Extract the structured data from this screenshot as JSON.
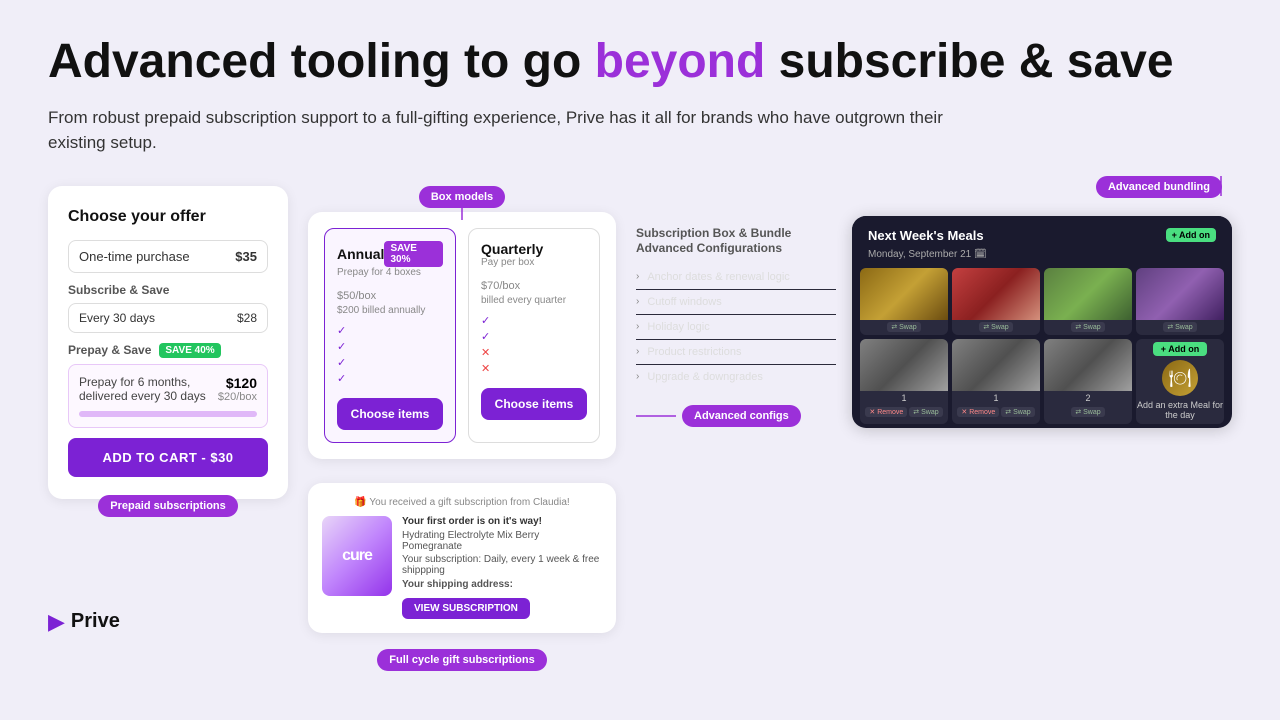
{
  "page": {
    "background": "#f0eef8"
  },
  "header": {
    "title_part1": "Advanced tooling to go ",
    "title_highlight": "beyond",
    "title_part2": " subscribe & save",
    "subtitle": "From robust prepaid subscription support to a full-gifting experience, Prive has it all for brands who have outgrown their existing setup."
  },
  "offer_card": {
    "title": "Choose your offer",
    "one_time": {
      "label": "One-time purchase",
      "price": "$35"
    },
    "subscribe_save": {
      "label": "Subscribe & Save",
      "frequency": "Every 30 days",
      "price": "$28"
    },
    "prepay_save": {
      "label": "Prepay & Save",
      "badge": "SAVE 40%",
      "description": "Prepay for 6 months, delivered every 30 days",
      "price": "$120",
      "per_box": "$20/box"
    },
    "add_to_cart": "ADD TO CART - $30",
    "tooltip": "Prepaid subscriptions"
  },
  "box_models": {
    "tooltip": "Box models",
    "annual": {
      "name": "Annual",
      "badge": "SAVE 30%",
      "sub": "Prepay for 4 boxes",
      "price": "$50",
      "per": "/box",
      "billed": "$200 billed annually",
      "features": [
        "check",
        "check",
        "check",
        "check"
      ],
      "btn": "Choose items"
    },
    "quarterly": {
      "name": "Quarterly",
      "sub": "Pay per box",
      "price": "$70",
      "per": "/box",
      "billed": "billed every quarter",
      "features": [
        "check",
        "check",
        "cross",
        "cross"
      ],
      "btn": "Choose items"
    }
  },
  "gift_card": {
    "header": "🎁 You received a gift subscription from Claudia!",
    "order_label": "Your first order is on it's way!",
    "product": "Hydrating Electrolyte Mix Berry Pomegranate",
    "details": "Your subscription: Daily, every 1 week & free shippping",
    "address_label": "Your shipping address:",
    "product_name": "cure",
    "subscribe_btn": "VIEW SUBSCRIPTION",
    "tooltip": "Full cycle gift subscriptions"
  },
  "dark_panel": {
    "title": "Next Week's Meals",
    "date": "Monday, September 21 🗓",
    "add_btn": "+ Add on",
    "meals": [
      {
        "img_class": "meal-img-1",
        "num": ""
      },
      {
        "img_class": "meal-img-2",
        "num": ""
      },
      {
        "img_class": "meal-img-3",
        "num": ""
      },
      {
        "img_class": "meal-img-4",
        "num": ""
      }
    ],
    "meals_row2": [
      {
        "img_class": "meal-img-5",
        "num": "1"
      },
      {
        "img_class": "meal-img-6",
        "num": "1"
      },
      {
        "img_class": "meal-img-7",
        "num": "2"
      },
      {
        "type": "add",
        "label": "Add an extra Meal for the day"
      }
    ],
    "config_title": "Subscription Box & Bundle Advanced Configurations",
    "config_items": [
      "Anchor dates & renewal logic",
      "Cutoff windows",
      "Holiday logic",
      "Product restrictions",
      "Upgrade & downgrades"
    ],
    "tooltip_advanced_configs": "Advanced configs",
    "tooltip_advanced_bundling": "Advanced bundling"
  },
  "logo": {
    "text": "Prive"
  }
}
